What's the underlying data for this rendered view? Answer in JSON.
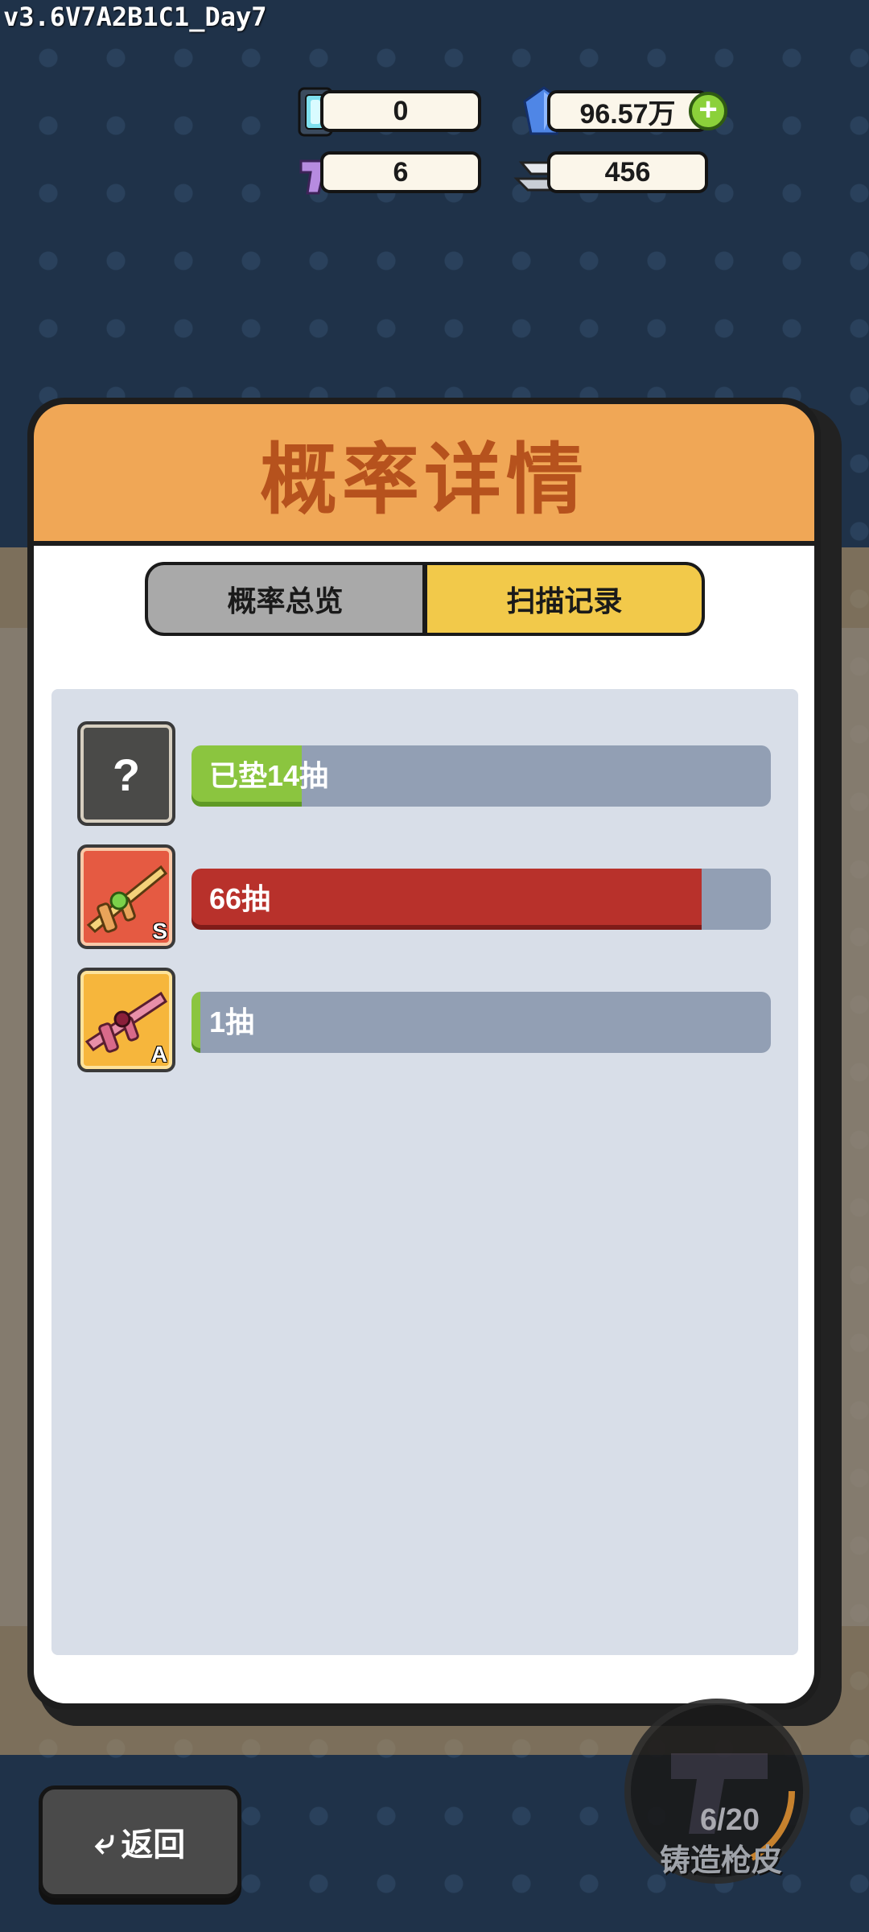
{
  "version": "v3.6V7A2B1C1_Day7",
  "currencies": {
    "chip": {
      "value": "0",
      "icon": "energy-chip-icon"
    },
    "gems": {
      "value": "96.57万",
      "icon": "blue-gem-icon",
      "add_icon": "plus-icon"
    },
    "pistol": {
      "value": "6",
      "icon": "purple-pistol-icon"
    },
    "silver": {
      "value": "456",
      "icon": "silver-ingot-icon"
    }
  },
  "modal": {
    "title": "概率详情",
    "tabs": [
      {
        "label": "概率总览",
        "active": false
      },
      {
        "label": "扫描记录",
        "active": true
      }
    ],
    "records": [
      {
        "icon": "mystery-box-icon",
        "symbol": "?",
        "label": "已垫14抽",
        "progress": 0.19,
        "color": "#8bc53f"
      },
      {
        "icon": "golden-rifle-s-icon",
        "grade": "S",
        "label": "66抽",
        "progress": 0.88,
        "color": "#b8312b"
      },
      {
        "icon": "pink-rifle-a-icon",
        "grade": "A",
        "label": "1抽",
        "progress": 0.015,
        "color": "#8bc53f"
      }
    ]
  },
  "bottom": {
    "back_label": "返回",
    "back_icon": "undo-arrow-icon",
    "forge_progress": "6/20",
    "forge_label": "铸造枪皮"
  }
}
